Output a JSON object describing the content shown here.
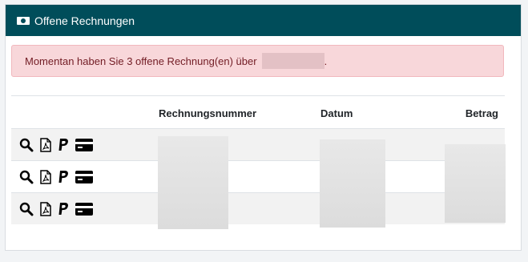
{
  "panel": {
    "title": "Offene Rechnungen",
    "title_icon": "money-bill-icon"
  },
  "alert": {
    "message": "Momentan haben Sie 3 offene Rechnung(en) über",
    "suffix": "."
  },
  "table": {
    "columns": [
      "Rechnungsnummer",
      "Datum",
      "Betrag"
    ],
    "row_actions": [
      "search-icon",
      "pdf-file-icon",
      "paypal-icon",
      "credit-card-icon"
    ],
    "rows": [
      {},
      {},
      {}
    ]
  },
  "colors": {
    "header_bg": "#004d5a",
    "alert_bg": "#f8d7da",
    "alert_text": "#721c24"
  }
}
